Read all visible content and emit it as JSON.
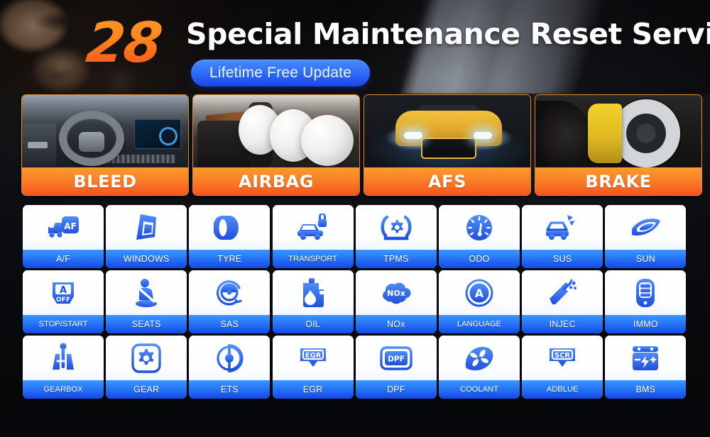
{
  "header": {
    "badge_number": "28",
    "title": "Special Maintenance Reset Service",
    "pill_label": "Lifetime Free Update",
    "accent_orange": "#fa8327",
    "accent_blue": "#2a7cf7",
    "title_color": "#ffffff"
  },
  "feature_cards": [
    {
      "label": "BLEED",
      "photo": "car-cockpit-steering-wheel-photo"
    },
    {
      "label": "AIRBAG",
      "photo": "deployed-airbags-interior-photo"
    },
    {
      "label": "AFS",
      "photo": "yellow-sports-car-headlights-photo"
    },
    {
      "label": "BRAKE",
      "photo": "brake-disc-yellow-caliper-photo"
    }
  ],
  "service_grid": {
    "rows": 3,
    "columns": 8,
    "items": [
      {
        "label": "A/F",
        "icon": "truck-af-icon"
      },
      {
        "label": "WINDOWS",
        "icon": "window-glass-icon"
      },
      {
        "label": "TYRE",
        "icon": "tyre-icon"
      },
      {
        "label": "TRANSPORT",
        "icon": "car-lock-icon"
      },
      {
        "label": "TPMS",
        "icon": "tyre-pressure-gear-icon"
      },
      {
        "label": "ODO",
        "icon": "odometer-gauge-icon"
      },
      {
        "label": "SUS",
        "icon": "car-suspension-icon"
      },
      {
        "label": "SUN",
        "icon": "sunroof-icon"
      },
      {
        "label": "STOP/START",
        "icon": "auto-stop-start-off-icon"
      },
      {
        "label": "SEATS",
        "icon": "seatbelt-passenger-icon"
      },
      {
        "label": "SAS",
        "icon": "steering-angle-sensor-icon"
      },
      {
        "label": "OIL",
        "icon": "oil-can-icon"
      },
      {
        "label": "NOx",
        "icon": "nox-cloud-icon"
      },
      {
        "label": "LANGUAGE",
        "icon": "language-letter-a-icon"
      },
      {
        "label": "INJEC",
        "icon": "fuel-injector-icon"
      },
      {
        "label": "IMMO",
        "icon": "immobilizer-key-fob-icon"
      },
      {
        "label": "GEARBOX",
        "icon": "gear-shifter-icon"
      },
      {
        "label": "GEAR",
        "icon": "gear-cog-square-icon"
      },
      {
        "label": "ETS",
        "icon": "throttle-body-icon"
      },
      {
        "label": "EGR",
        "icon": "egr-valve-icon"
      },
      {
        "label": "DPF",
        "icon": "dpf-filter-icon"
      },
      {
        "label": "COOLANT",
        "icon": "coolant-fan-icon"
      },
      {
        "label": "ADBLUE",
        "icon": "scr-adblue-icon"
      },
      {
        "label": "BMS",
        "icon": "battery-management-icon"
      }
    ]
  }
}
